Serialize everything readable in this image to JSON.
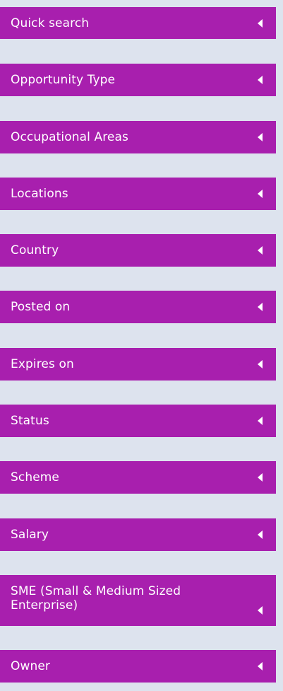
{
  "filters": {
    "items": [
      {
        "label": "Quick search",
        "icon": "caret-left-icon"
      },
      {
        "label": "Opportunity Type",
        "icon": "caret-left-icon"
      },
      {
        "label": "Occupational Areas",
        "icon": "caret-left-icon"
      },
      {
        "label": "Locations",
        "icon": "caret-left-icon"
      },
      {
        "label": "Country",
        "icon": "caret-left-icon"
      },
      {
        "label": "Posted on",
        "icon": "caret-left-icon"
      },
      {
        "label": "Expires on",
        "icon": "caret-left-icon"
      },
      {
        "label": "Status",
        "icon": "caret-left-icon"
      },
      {
        "label": "Scheme",
        "icon": "caret-left-icon"
      },
      {
        "label": "Salary",
        "icon": "caret-left-icon"
      },
      {
        "label": "SME (Small & Medium Sized Enterprise)",
        "icon": "caret-left-icon"
      },
      {
        "label": "Owner",
        "icon": "caret-left-icon"
      }
    ]
  },
  "colors": {
    "background": "#dde3ee",
    "header": "#a81fae",
    "text": "#ffffff"
  }
}
